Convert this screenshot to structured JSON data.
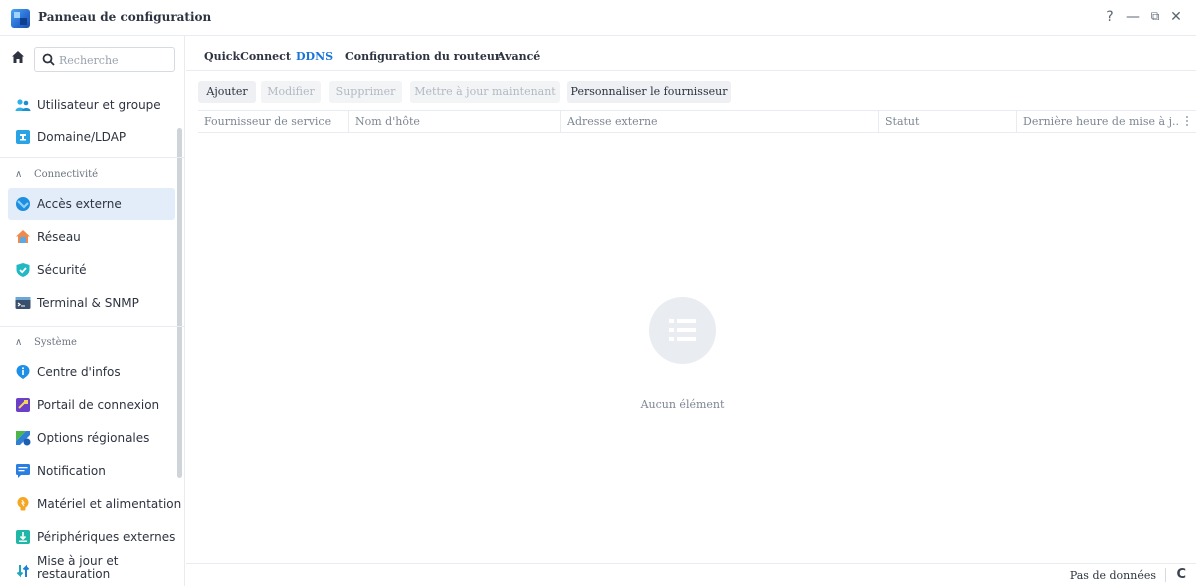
{
  "window": {
    "title": "Panneau de configuration",
    "controls": {
      "help": "?",
      "minimize": "—",
      "restore": "⧉",
      "close": "✕"
    }
  },
  "sidebar": {
    "search_placeholder": "Recherche",
    "sections": {
      "connectivite": "Connectivité",
      "systeme": "Système"
    },
    "items": [
      {
        "label": "Utilisateur et groupe",
        "icon": "users-icon"
      },
      {
        "label": "Domaine/LDAP",
        "icon": "domain-icon"
      },
      {
        "label": "Accès externe",
        "icon": "external-access-icon",
        "active": true
      },
      {
        "label": "Réseau",
        "icon": "network-icon"
      },
      {
        "label": "Sécurité",
        "icon": "shield-icon"
      },
      {
        "label": "Terminal & SNMP",
        "icon": "terminal-icon"
      },
      {
        "label": "Centre d'infos",
        "icon": "info-icon"
      },
      {
        "label": "Portail de connexion",
        "icon": "login-portal-icon"
      },
      {
        "label": "Options régionales",
        "icon": "regional-icon"
      },
      {
        "label": "Notification",
        "icon": "notification-icon"
      },
      {
        "label": "Matériel et alimentation",
        "icon": "hardware-icon"
      },
      {
        "label": "Périphériques externes",
        "icon": "external-devices-icon"
      },
      {
        "label_line1": "Mise à jour et",
        "label_line2": "restauration",
        "icon": "update-icon"
      }
    ]
  },
  "tabs": [
    {
      "label": "QuickConnect"
    },
    {
      "label": "DDNS",
      "active": true
    },
    {
      "label": "Configuration du routeur"
    },
    {
      "label": "Avancé"
    }
  ],
  "toolbar": {
    "add": "Ajouter",
    "edit": "Modifier",
    "delete": "Supprimer",
    "update_now": "Mettre à jour maintenant",
    "customize_provider": "Personnaliser le fournisseur"
  },
  "table": {
    "columns": [
      "Fournisseur de service",
      "Nom d'hôte",
      "Adresse externe",
      "Statut",
      "Dernière heure de mise à j..."
    ],
    "empty_text": "Aucun élément"
  },
  "footer": {
    "status": "Pas de données",
    "refresh_icon": "refresh-icon"
  },
  "colors": {
    "accent": "#1a73d9",
    "active_bg": "#e3edfa"
  }
}
